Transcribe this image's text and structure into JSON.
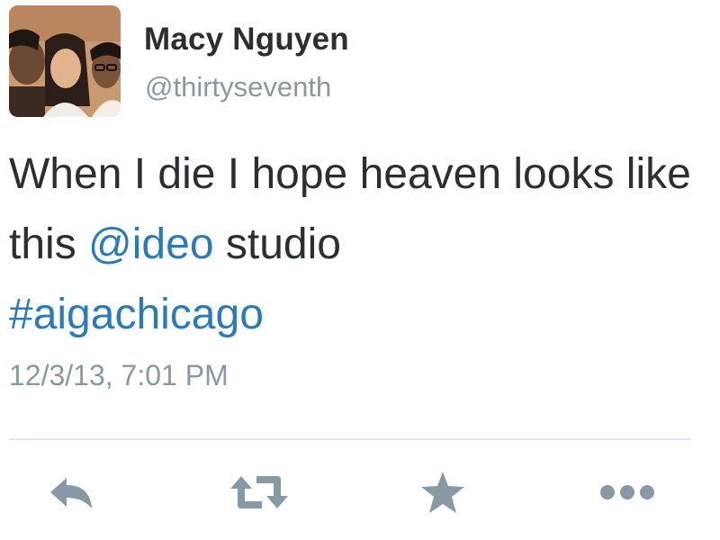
{
  "tweet": {
    "display_name": "Macy Nguyen",
    "handle": "@thirtyseventh",
    "text": {
      "part1": "When I die I hope heaven looks like this ",
      "mention": "@ideo",
      "part2": " studio",
      "hashtag": "#aigachicago"
    },
    "timestamp": "12/3/13, 7:01 PM"
  },
  "actions": [
    {
      "name": "reply",
      "icon": "reply-icon"
    },
    {
      "name": "retweet",
      "icon": "retweet-icon"
    },
    {
      "name": "favorite",
      "icon": "star-icon"
    },
    {
      "name": "more",
      "icon": "more-icon"
    }
  ],
  "colors": {
    "text": "#292f33",
    "secondary": "#8899a6",
    "link": "#2b7bb9",
    "action_icon": "#8899a6",
    "divider": "#e1e8ed"
  }
}
